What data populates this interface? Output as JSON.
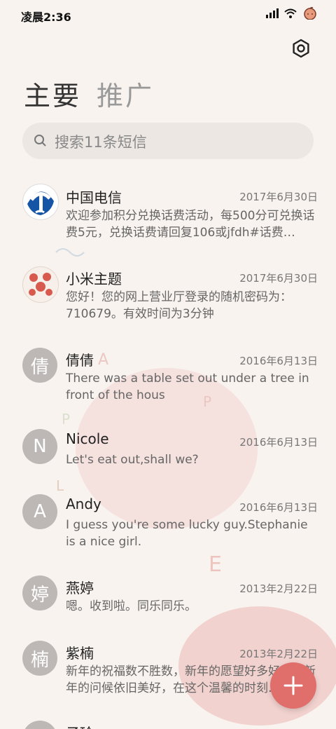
{
  "status": {
    "time": "凌晨2:36"
  },
  "tabs": [
    {
      "label": "主要"
    },
    {
      "label": "推广"
    }
  ],
  "search": {
    "placeholder": "搜索11条短信"
  },
  "messages": [
    {
      "sender": "中国电信",
      "date": "2017年6月30日",
      "preview": "欢迎参加积分兑换话费活动，每500分可兑换话费5元，兑换话费请回复106或jfdh#话费…",
      "avatar": ""
    },
    {
      "sender": "小米主题",
      "date": "2017年6月30日",
      "preview": "您好！您的网上营业厅登录的随机密码为：710679。有效时间为3分钟",
      "avatar": ""
    },
    {
      "sender": "倩倩",
      "date": "2016年6月13日",
      "preview": "There was a table set out under a tree in front of the hous",
      "avatar": "倩"
    },
    {
      "sender": "Nicole",
      "date": "2016年6月13日",
      "preview": "Let's eat out,shall we?",
      "avatar": "N"
    },
    {
      "sender": "Andy",
      "date": "2016年6月13日",
      "preview": "I guess you're some lucky guy.Stephanie is a nice girl.",
      "avatar": "A"
    },
    {
      "sender": "燕婷",
      "date": "2013年2月22日",
      "preview": "嗯。收到啦。同乐同乐。",
      "avatar": "婷"
    },
    {
      "sender": "紫楠",
      "date": "2013年2月22日",
      "preview": "新年的祝福数不胜数，新年的愿望好多好多，新年的问候依旧美好，在这个温馨的时刻…",
      "avatar": "楠"
    },
    {
      "sender": "子玲",
      "date": "",
      "preview": "",
      "avatar": ""
    }
  ],
  "colors": {
    "fab": "#e06e6b",
    "background": "#f8f3ef",
    "avatar_gray": "#bdb8b5"
  },
  "icons": {
    "settings": "settings-icon",
    "search": "search-icon",
    "add": "plus-icon"
  }
}
